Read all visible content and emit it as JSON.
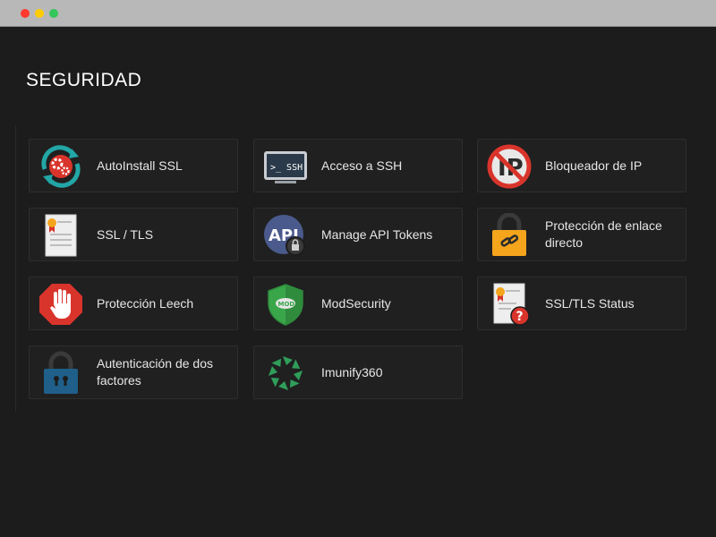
{
  "window": {
    "controls": [
      "close",
      "minimize",
      "maximize"
    ]
  },
  "section": {
    "title": "SEGURIDAD"
  },
  "items": [
    {
      "label": "AutoInstall SSL",
      "icon": "autoinstall-ssl-icon"
    },
    {
      "label": "Acceso a SSH",
      "icon": "ssh-terminal-icon"
    },
    {
      "label": "Bloqueador de IP",
      "icon": "ip-blocker-icon"
    },
    {
      "label": "SSL / TLS",
      "icon": "certificate-icon"
    },
    {
      "label": "Manage API Tokens",
      "icon": "api-token-icon"
    },
    {
      "label": "Protección de enlace directo",
      "icon": "link-lock-icon"
    },
    {
      "label": "Protección Leech",
      "icon": "stop-hand-icon"
    },
    {
      "label": "ModSecurity",
      "icon": "modsecurity-shield-icon"
    },
    {
      "label": "SSL/TLS Status",
      "icon": "certificate-status-icon"
    },
    {
      "label": "Autenticación de dos factores",
      "icon": "padlock-icon"
    },
    {
      "label": "Imunify360",
      "icon": "imunify360-icon"
    }
  ]
}
